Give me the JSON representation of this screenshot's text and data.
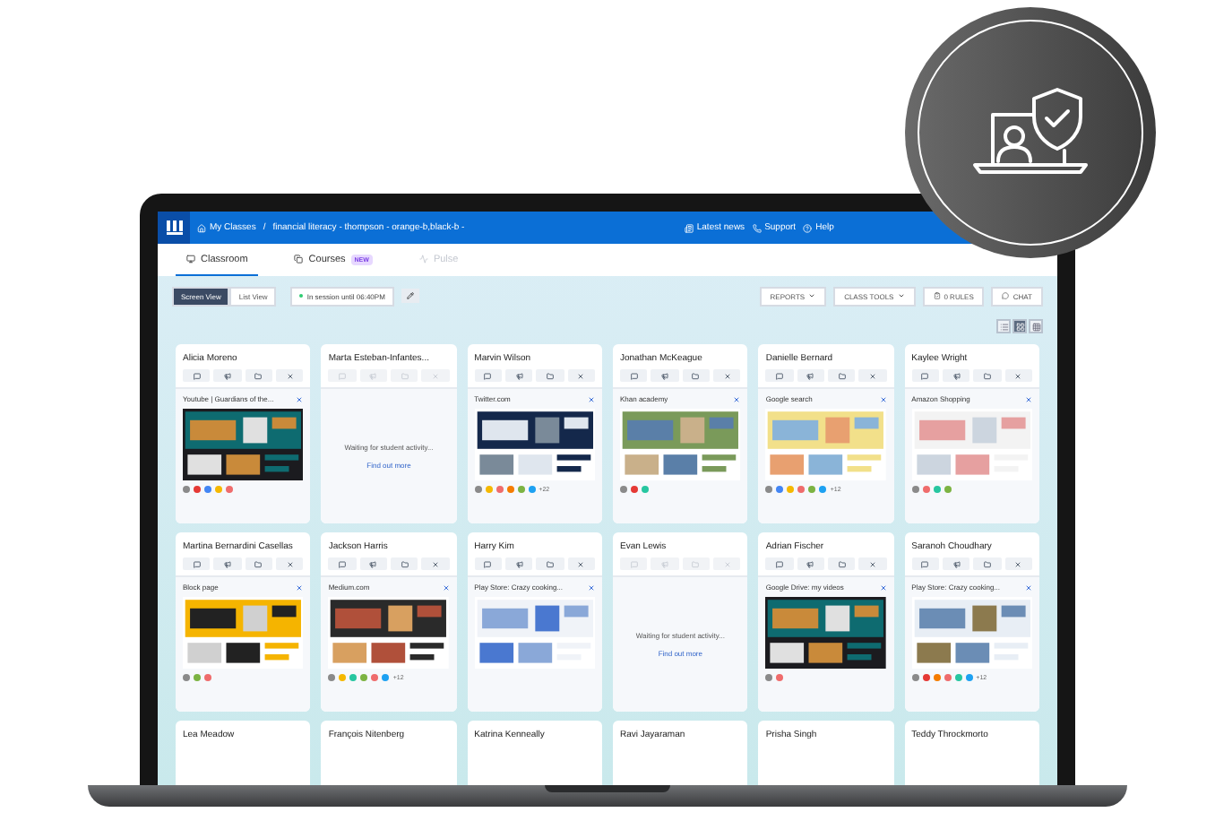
{
  "nav": {
    "home": "My Classes",
    "separator": "/",
    "class_name": "financial literacy - thompson - orange-b,black-b -",
    "links": [
      "Latest news",
      "Support",
      "Help"
    ]
  },
  "tabs": [
    {
      "label": "Classroom",
      "selected": true,
      "disabled": false
    },
    {
      "label": "Courses",
      "badge": "NEW",
      "selected": false,
      "disabled": false
    },
    {
      "label": "Pulse",
      "selected": false,
      "disabled": true
    }
  ],
  "views": [
    {
      "label": "Screen View",
      "selected": true
    },
    {
      "label": "List View",
      "selected": false
    }
  ],
  "session": "In session until 06:40PM",
  "actions": [
    {
      "label": "REPORTS",
      "kind": "dropdown"
    },
    {
      "label": "CLASS TOOLS",
      "kind": "dropdown"
    },
    {
      "label": "0 RULES",
      "kind": "rules"
    },
    {
      "label": "CHAT",
      "kind": "chat"
    }
  ],
  "layouts": [
    {
      "selected": false
    },
    {
      "selected": true
    },
    {
      "selected": false
    }
  ],
  "students": [
    {
      "name": "Alicia Moreno",
      "kind": "active",
      "tab": "Youtube | Guardians of the...",
      "preview": {
        "kind": "picture"
      },
      "favicons": [
        {
          "color": "#8a8a8a"
        },
        {
          "color": "#e53935"
        },
        {
          "color": "#4285f4"
        },
        {
          "color": "#f5b800"
        },
        {
          "color": "#ef6c6c"
        }
      ]
    },
    {
      "name": "Marta Esteban-Infantes...",
      "kind": "waiting",
      "message": "Waiting for student activity...",
      "link": "Find out more"
    },
    {
      "name": "Marvin Wilson",
      "kind": "active",
      "tab": "Twitter.com",
      "preview": {
        "kind": "picture"
      },
      "favicons": [
        {
          "color": "#8a8a8a"
        },
        {
          "color": "#f5b800"
        },
        {
          "color": "#ef6c6c"
        },
        {
          "color": "#f57c00"
        },
        {
          "color": "#7cb342"
        },
        {
          "color": "#1da1f2"
        }
      ],
      "more": "+22"
    },
    {
      "name": "Jonathan McKeague",
      "kind": "active",
      "tab": "Khan academy",
      "preview": {
        "kind": "picture"
      },
      "favicons": [
        {
          "color": "#8a8a8a"
        },
        {
          "color": "#e53935"
        },
        {
          "color": "#26c6a0"
        }
      ]
    },
    {
      "name": "Danielle Bernard",
      "kind": "active",
      "tab": "Google search",
      "preview": {
        "kind": "picture"
      },
      "favicons": [
        {
          "color": "#8a8a8a"
        },
        {
          "color": "#4285f4"
        },
        {
          "color": "#f5b800"
        },
        {
          "color": "#ef6c6c"
        },
        {
          "color": "#7cb342"
        },
        {
          "color": "#1da1f2"
        }
      ],
      "more": "+12"
    },
    {
      "name": "Kaylee Wright",
      "kind": "active",
      "tab": "Amazon Shopping",
      "preview": {
        "kind": "picture"
      },
      "favicons": [
        {
          "color": "#8a8a8a"
        },
        {
          "color": "#ef6c6c"
        },
        {
          "color": "#26c6a0"
        },
        {
          "color": "#7cb342"
        }
      ]
    },
    {
      "name": "Martina Bernardini Casellas",
      "kind": "active",
      "tab": "Block page",
      "preview": {
        "kind": "picture"
      },
      "favicons": [
        {
          "color": "#8a8a8a"
        },
        {
          "color": "#7cb342"
        },
        {
          "color": "#ef6c6c"
        }
      ]
    },
    {
      "name": "Jackson Harris",
      "kind": "active",
      "tab": "Medium.com",
      "preview": {
        "kind": "picture"
      },
      "favicons": [
        {
          "color": "#8a8a8a"
        },
        {
          "color": "#f5b800"
        },
        {
          "color": "#26c6a0"
        },
        {
          "color": "#7cb342"
        },
        {
          "color": "#ef6c6c"
        },
        {
          "color": "#1da1f2"
        }
      ],
      "more": "+12"
    },
    {
      "name": "Harry Kim",
      "kind": "active",
      "tab": "Play Store: Crazy cooking...",
      "preview": {
        "kind": "picture"
      }
    },
    {
      "name": "Evan Lewis",
      "kind": "waiting",
      "message": "Waiting for student activity...",
      "link": "Find out more"
    },
    {
      "name": "Adrian Fischer",
      "kind": "active",
      "tab": "Google Drive: my videos",
      "preview": {
        "kind": "picture"
      },
      "favicons": [
        {
          "color": "#8a8a8a"
        },
        {
          "color": "#ef6c6c"
        }
      ]
    },
    {
      "name": "Saranoh Choudhary",
      "kind": "active",
      "tab": "Play Store: Crazy cooking...",
      "preview": {
        "kind": "picture"
      },
      "favicons": [
        {
          "color": "#8a8a8a"
        },
        {
          "color": "#e53935"
        },
        {
          "color": "#f57c00"
        },
        {
          "color": "#ef6c6c"
        },
        {
          "color": "#26c6a0"
        },
        {
          "color": "#1da1f2"
        }
      ],
      "more": "+12"
    },
    {
      "name": "Lea Meadow"
    },
    {
      "name": "François Nitenberg"
    },
    {
      "name": "Katrina Kenneally"
    },
    {
      "name": "Ravi Jayaraman"
    },
    {
      "name": "Prisha Singh"
    },
    {
      "name": "Teddy Throckmorto"
    }
  ]
}
